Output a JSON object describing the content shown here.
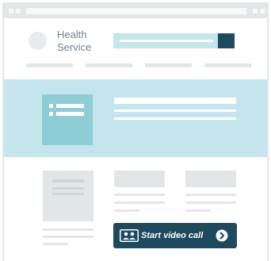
{
  "brand": {
    "name": "Health Service"
  },
  "cta": {
    "label": "Start video call",
    "icon": "video-call-icon"
  },
  "colors": {
    "chrome": "#e3e6e7",
    "hero_background": "#c4e5ec",
    "hero_card": "#8ccdd6",
    "primary": "#1d4a5e",
    "placeholder": "#e3e6e7"
  }
}
